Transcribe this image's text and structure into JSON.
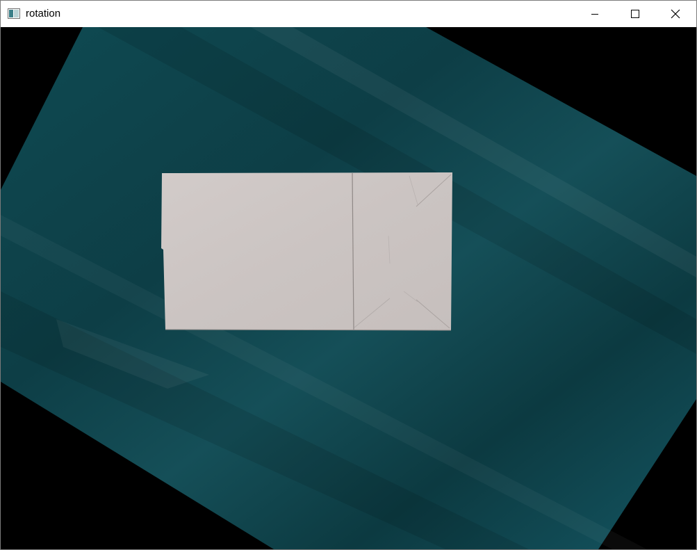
{
  "window": {
    "title": "rotation",
    "icons": {
      "app": "app-window-icon",
      "minimize": "minimize-icon",
      "maximize": "maximize-icon",
      "close": "close-icon"
    }
  },
  "image_view": {
    "description_colors": {
      "background": "#000000",
      "board": "#11434b",
      "paper": "#cdc6c4"
    }
  }
}
